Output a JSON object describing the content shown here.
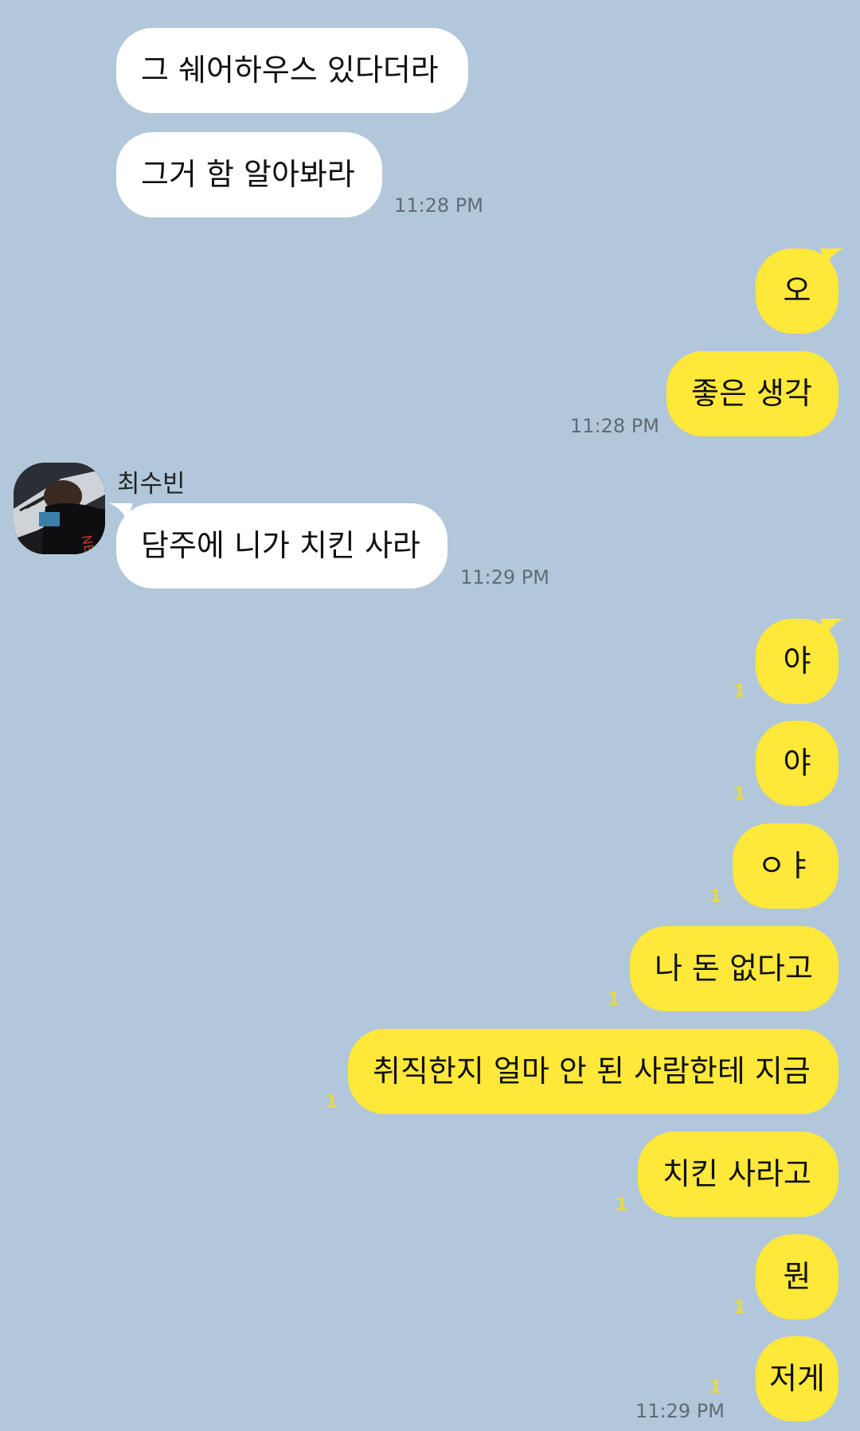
{
  "messages": [
    {
      "text": "그 쉐어하우스 있다더라"
    },
    {
      "text": "그거 함 알아봐라",
      "time": "11:28 PM"
    },
    {
      "text": "오"
    },
    {
      "text": "좋은 생각",
      "time": "11:28 PM"
    },
    {
      "sender": "최수빈",
      "text": "담주에 니가 치킨 사라",
      "time": "11:29 PM"
    },
    {
      "text": "야",
      "unread": "1"
    },
    {
      "text": "야",
      "unread": "1"
    },
    {
      "text": "ㅇㅑ",
      "unread": "1"
    },
    {
      "text": "나 돈 없다고",
      "unread": "1"
    },
    {
      "text": "취직한지 얼마 안 된 사람한테 지금",
      "unread": "1"
    },
    {
      "text": "치킨 사라고",
      "unread": "1"
    },
    {
      "text": "뭔",
      "unread": "1"
    },
    {
      "text": "저게",
      "unread": "1",
      "time": "11:29 PM"
    }
  ],
  "colors": {
    "background": "#b2c7da",
    "incoming_bubble": "#ffffff",
    "outgoing_bubble": "#fee83a",
    "unread_count": "#e6d94a",
    "timestamp": "#5f6b77"
  },
  "avatar_icon": "profile-photo-icon"
}
